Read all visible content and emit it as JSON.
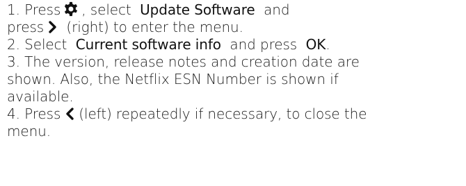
{
  "step1": {
    "pre": "1. Press",
    "icon": "gear-icon",
    "mid": ", select",
    "kw": "Update Software",
    "post": "and",
    "line2_pre": "press",
    "line2_icon": "chevron-right-icon",
    "line2_post": "(right) to enter the menu."
  },
  "step2": {
    "pre": "2. Select",
    "kw1": "Current software info",
    "mid": "and press",
    "kw2": "OK",
    "post": "."
  },
  "step3": {
    "line1": "3. The version, release notes and creation date are",
    "line2": "shown. Also, the Netflix ESN Number is shown if",
    "line3": "available."
  },
  "step4": {
    "pre": "4. Press",
    "icon": "chevron-left-icon",
    "line1_post": "(left) repeatedly if necessary, to close the",
    "line2": "menu."
  }
}
